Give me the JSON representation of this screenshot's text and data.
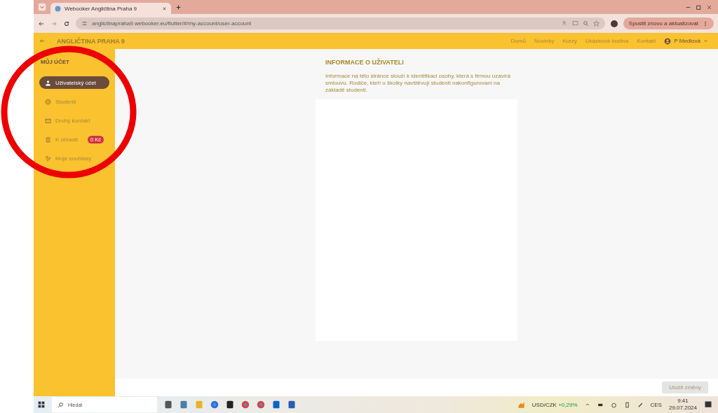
{
  "browser": {
    "tab_title": "Webooker Angličtina Praha 9",
    "url": "anglictinapraha9.webooker.eu/flutter/#/my-account/user-account",
    "update_button": "Spustit znovu a aktualizovat"
  },
  "app_header": {
    "title": "ANGLIČTINA PRAHA 9",
    "nav": [
      "Domů",
      "Novinky",
      "Kurzy",
      "Ukázková hodina",
      "Kontakt"
    ],
    "user": "P Medlová"
  },
  "sidebar": {
    "heading": "MŮJ ÚČET",
    "items": [
      {
        "label": "Uživatelský účet",
        "selected": true
      },
      {
        "label": "Studenti",
        "selected": false
      },
      {
        "label": "Druhý kontakt",
        "selected": false
      },
      {
        "label": "K úhradě",
        "selected": false,
        "badge": "0 Kč"
      },
      {
        "label": "Moje souhlasy",
        "selected": false
      }
    ]
  },
  "content": {
    "title": "INFORMACE O UŽIVATELI",
    "description": "Informace na této stránce slouží k identifikaci osoby, která s firmou uzavírá smlouvu. Rodiče, kteří u školky navštěvují studenti nakonfigurovaní na základě studenti."
  },
  "save_button": {
    "label": "Uložit změny",
    "disabled": true
  },
  "taskbar": {
    "search_placeholder": "Hledat",
    "ticker": "USD/CZK",
    "ticker_change": "+0,29%",
    "language": "CES",
    "time": "9:41",
    "date": "29.07.2024"
  },
  "annotations": [
    {
      "kind": "circle",
      "color": "#ee0000"
    }
  ]
}
